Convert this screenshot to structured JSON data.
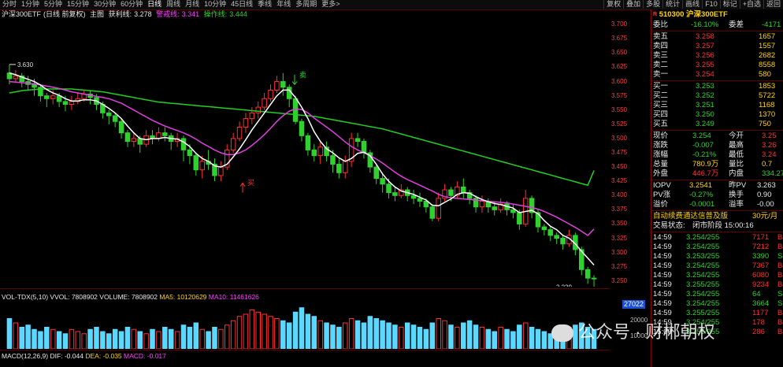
{
  "toolbar": {
    "left": [
      "分时",
      "1分钟",
      "5分钟",
      "15分钟",
      "30分钟",
      "60分钟",
      "日线",
      "周线",
      "月线",
      "10分钟",
      "45日线",
      "季线",
      "年线",
      "多周期",
      "更多>"
    ],
    "active_index": 6,
    "right": [
      "复权",
      "叠加",
      "多股",
      "统计",
      "画线",
      "F10",
      "标记",
      "+自选",
      "返回"
    ]
  },
  "header": {
    "name": "沪深300ETF",
    "mode": "(日线 前复权)",
    "main_label": "主图",
    "l1_name": "获利线:",
    "l1_value": "3.278",
    "l2_name": "警戒线:",
    "l2_value": "3.341",
    "l3_name": "操作线:",
    "l3_value": "3.444"
  },
  "price_axis": [
    "3.700",
    "3.675",
    "3.650",
    "3.625",
    "3.600",
    "3.575",
    "3.550",
    "3.525",
    "3.500",
    "3.475",
    "3.450",
    "3.425",
    "3.400",
    "3.375",
    "3.350",
    "3.325",
    "3.300",
    "3.275",
    "3.250"
  ],
  "annotations": {
    "high": "3.630",
    "low": "3.239",
    "sell": "卖",
    "buy": "买"
  },
  "volume": {
    "label": "VOL-TDX(5,10)",
    "vvol": "VVOL: 7808902",
    "volume": "VOLUME: 7808902",
    "ma5": "MA5: 10120629",
    "ma10": "MA10: 11461626",
    "box": "27022",
    "tick": "20000",
    "tick2": "10000"
  },
  "macd": {
    "label": "MACD(12,26,9)",
    "dif": "DIF: -0.044",
    "dea": "DEA: -0.035",
    "macd": "MACD: -0.017"
  },
  "panel": {
    "code": "510300",
    "name": "沪深300ETF",
    "weibi": {
      "l1": "委比",
      "v1": "-16.10%",
      "l2": "委差",
      "v2": "-4171"
    },
    "asks": [
      {
        "label": "卖五",
        "price": "3.258",
        "vol": "1657"
      },
      {
        "label": "卖四",
        "price": "3.257",
        "vol": "1557"
      },
      {
        "label": "卖三",
        "price": "3.256",
        "vol": "2682"
      },
      {
        "label": "卖二",
        "price": "3.255",
        "vol": "8558"
      },
      {
        "label": "卖一",
        "price": "3.254",
        "vol": "580"
      }
    ],
    "bids": [
      {
        "label": "买一",
        "price": "3.253",
        "vol": "1853"
      },
      {
        "label": "买二",
        "price": "3.252",
        "vol": "5722"
      },
      {
        "label": "买三",
        "price": "3.251",
        "vol": "1168"
      },
      {
        "label": "买四",
        "price": "3.250",
        "vol": "1370"
      },
      {
        "label": "买五",
        "price": "3.249",
        "vol": "750"
      }
    ],
    "stats": [
      {
        "l1": "现价",
        "v1": "3.254",
        "l2": "今开",
        "v2": "3.25"
      },
      {
        "l1": "涨跌",
        "v1": "-0.007",
        "l2": "最高",
        "v2": "3.26"
      },
      {
        "l1": "涨幅",
        "v1": "-0.21%",
        "l2": "最低",
        "v2": "3.24"
      },
      {
        "l1": "总量",
        "v1": "780.9万",
        "l2": "量比",
        "v2": "0.7"
      },
      {
        "l1": "外盘",
        "v1": "446.7万",
        "l2": "内盘",
        "v2": "334.27"
      }
    ],
    "iopv": [
      {
        "l1": "IOPV",
        "v1": "3.2541",
        "l2": "昨PV",
        "v2": "3.263"
      },
      {
        "l1": "PV涨",
        "v1": "-0.27%",
        "l2": "换手",
        "v2": "0.90"
      },
      {
        "l1": "溢价",
        "v1": "-0.0001",
        "l2": "溢率",
        "v2": "-0.00"
      }
    ],
    "promo": {
      "text": "自动续费通达信普及版",
      "price": "30元/月"
    },
    "status": {
      "label": "交易状态:",
      "value": "闭市阶段 15:00:16"
    },
    "trades": [
      {
        "time": "14:59",
        "price": "3.254/255",
        "vol": "7171",
        "flag": "B"
      },
      {
        "time": "14:59",
        "price": "3.254/255",
        "vol": "7212",
        "flag": "B"
      },
      {
        "time": "14:59",
        "price": "3.253/255",
        "vol": "3390",
        "flag": "S"
      },
      {
        "time": "14:59",
        "price": "3.254/255",
        "vol": "7367",
        "flag": "B"
      },
      {
        "time": "14:59",
        "price": "3.254/255",
        "vol": "6080",
        "flag": "B"
      },
      {
        "time": "14:59",
        "price": "3.255/255",
        "vol": "9234",
        "flag": "B"
      },
      {
        "time": "14:59",
        "price": "3.254/255",
        "vol": "64",
        "flag": "S"
      },
      {
        "time": "14:59",
        "price": "3.254/255",
        "vol": "3664",
        "flag": "S"
      },
      {
        "time": "14:59",
        "price": "3.255/255",
        "vol": "1177",
        "flag": "B"
      },
      {
        "time": "14:59",
        "price": "3.254/255",
        "vol": "178",
        "flag": "B"
      },
      {
        "time": "15:00",
        "price": "3.255/255",
        "vol": "286",
        "flag": "B"
      }
    ]
  },
  "watermark": {
    "text": "公众号 · 财郴朝权"
  },
  "colors": {
    "up": "#ff3030",
    "down": "#2fd12f",
    "ma_white": "#ffffff",
    "ma_magenta": "#e040e0",
    "ma_green": "#22d022",
    "vol_bar": "#5ad8ff"
  },
  "chart_data": {
    "type": "candlestick",
    "ylim": [
      3.24,
      3.71
    ],
    "candles": [
      [
        3.615,
        3.605,
        3.63,
        3.595
      ],
      [
        3.605,
        3.61,
        3.62,
        3.598
      ],
      [
        3.61,
        3.6,
        3.615,
        3.59
      ],
      [
        3.6,
        3.595,
        3.61,
        3.585
      ],
      [
        3.595,
        3.59,
        3.605,
        3.575
      ],
      [
        3.59,
        3.575,
        3.595,
        3.565
      ],
      [
        3.575,
        3.57,
        3.58,
        3.555
      ],
      [
        3.57,
        3.575,
        3.585,
        3.56
      ],
      [
        3.575,
        3.565,
        3.58,
        3.555
      ],
      [
        3.565,
        3.56,
        3.575,
        3.548
      ],
      [
        3.56,
        3.565,
        3.575,
        3.55
      ],
      [
        3.565,
        3.57,
        3.58,
        3.56
      ],
      [
        3.57,
        3.578,
        3.585,
        3.565
      ],
      [
        3.578,
        3.572,
        3.585,
        3.56
      ],
      [
        3.572,
        3.56,
        3.578,
        3.55
      ],
      [
        3.56,
        3.545,
        3.565,
        3.535
      ],
      [
        3.545,
        3.54,
        3.55,
        3.525
      ],
      [
        3.54,
        3.53,
        3.545,
        3.52
      ],
      [
        3.53,
        3.51,
        3.535,
        3.5
      ],
      [
        3.51,
        3.495,
        3.515,
        3.485
      ],
      [
        3.495,
        3.5,
        3.51,
        3.485
      ],
      [
        3.5,
        3.49,
        3.505,
        3.475
      ],
      [
        3.49,
        3.505,
        3.515,
        3.485
      ],
      [
        3.505,
        3.5,
        3.515,
        3.49
      ],
      [
        3.5,
        3.51,
        3.52,
        3.495
      ],
      [
        3.51,
        3.505,
        3.52,
        3.495
      ],
      [
        3.505,
        3.495,
        3.51,
        3.48
      ],
      [
        3.495,
        3.5,
        3.51,
        3.485
      ],
      [
        3.5,
        3.48,
        3.505,
        3.46
      ],
      [
        3.48,
        3.47,
        3.49,
        3.455
      ],
      [
        3.47,
        3.445,
        3.475,
        3.435
      ],
      [
        3.445,
        3.46,
        3.47,
        3.43
      ],
      [
        3.46,
        3.455,
        3.48,
        3.445
      ],
      [
        3.455,
        3.435,
        3.465,
        3.425
      ],
      [
        3.435,
        3.45,
        3.46,
        3.425
      ],
      [
        3.45,
        3.48,
        3.49,
        3.445
      ],
      [
        3.48,
        3.5,
        3.51,
        3.475
      ],
      [
        3.5,
        3.52,
        3.53,
        3.495
      ],
      [
        3.52,
        3.535,
        3.545,
        3.51
      ],
      [
        3.535,
        3.545,
        3.555,
        3.525
      ],
      [
        3.545,
        3.555,
        3.565,
        3.535
      ],
      [
        3.555,
        3.57,
        3.58,
        3.55
      ],
      [
        3.57,
        3.585,
        3.595,
        3.565
      ],
      [
        3.585,
        3.6,
        3.61,
        3.58
      ],
      [
        3.6,
        3.59,
        3.615,
        3.575
      ],
      [
        3.59,
        3.57,
        3.595,
        3.555
      ],
      [
        3.57,
        3.53,
        3.575,
        3.525
      ],
      [
        3.53,
        3.505,
        3.535,
        3.495
      ],
      [
        3.505,
        3.48,
        3.51,
        3.47
      ],
      [
        3.48,
        3.47,
        3.49,
        3.46
      ],
      [
        3.47,
        3.485,
        3.495,
        3.455
      ],
      [
        3.485,
        3.47,
        3.495,
        3.46
      ],
      [
        3.47,
        3.455,
        3.48,
        3.44
      ],
      [
        3.455,
        3.44,
        3.465,
        3.43
      ],
      [
        3.44,
        3.46,
        3.47,
        3.43
      ],
      [
        3.46,
        3.5,
        3.51,
        3.45
      ],
      [
        3.5,
        3.495,
        3.51,
        3.485
      ],
      [
        3.495,
        3.475,
        3.5,
        3.465
      ],
      [
        3.475,
        3.45,
        3.48,
        3.44
      ],
      [
        3.45,
        3.43,
        3.455,
        3.42
      ],
      [
        3.43,
        3.42,
        3.44,
        3.405
      ],
      [
        3.42,
        3.405,
        3.43,
        3.395
      ],
      [
        3.405,
        3.4,
        3.415,
        3.39
      ],
      [
        3.4,
        3.41,
        3.42,
        3.395
      ],
      [
        3.41,
        3.4,
        3.415,
        3.39
      ],
      [
        3.4,
        3.395,
        3.41,
        3.385
      ],
      [
        3.395,
        3.39,
        3.405,
        3.38
      ],
      [
        3.39,
        3.38,
        3.395,
        3.37
      ],
      [
        3.38,
        3.36,
        3.385,
        3.355
      ],
      [
        3.36,
        3.395,
        3.405,
        3.355
      ],
      [
        3.395,
        3.41,
        3.42,
        3.39
      ],
      [
        3.41,
        3.4,
        3.415,
        3.39
      ],
      [
        3.4,
        3.415,
        3.425,
        3.395
      ],
      [
        3.415,
        3.405,
        3.43,
        3.395
      ],
      [
        3.405,
        3.395,
        3.41,
        3.385
      ],
      [
        3.395,
        3.38,
        3.4,
        3.37
      ],
      [
        3.38,
        3.39,
        3.4,
        3.37
      ],
      [
        3.39,
        3.38,
        3.395,
        3.37
      ],
      [
        3.38,
        3.375,
        3.39,
        3.365
      ],
      [
        3.375,
        3.385,
        3.395,
        3.37
      ],
      [
        3.385,
        3.375,
        3.39,
        3.365
      ],
      [
        3.375,
        3.37,
        3.385,
        3.36
      ],
      [
        3.37,
        3.35,
        3.375,
        3.34
      ],
      [
        3.35,
        3.395,
        3.41,
        3.345
      ],
      [
        3.395,
        3.37,
        3.4,
        3.36
      ],
      [
        3.37,
        3.345,
        3.375,
        3.335
      ],
      [
        3.345,
        3.34,
        3.35,
        3.33
      ],
      [
        3.34,
        3.33,
        3.345,
        3.32
      ],
      [
        3.33,
        3.325,
        3.335,
        3.315
      ],
      [
        3.325,
        3.315,
        3.33,
        3.305
      ],
      [
        3.315,
        3.33,
        3.34,
        3.31
      ],
      [
        3.33,
        3.305,
        3.335,
        3.295
      ],
      [
        3.305,
        3.27,
        3.31,
        3.26
      ],
      [
        3.27,
        3.255,
        3.275,
        3.245
      ],
      [
        3.255,
        3.254,
        3.26,
        3.239
      ]
    ],
    "ma_white": [
      3.615,
      3.612,
      3.608,
      3.604,
      3.6,
      3.594,
      3.586,
      3.58,
      3.576,
      3.57,
      3.566,
      3.566,
      3.568,
      3.568,
      3.566,
      3.56,
      3.553,
      3.545,
      3.535,
      3.522,
      3.51,
      3.5,
      3.498,
      3.5,
      3.5,
      3.502,
      3.5,
      3.499,
      3.494,
      3.486,
      3.474,
      3.465,
      3.46,
      3.452,
      3.45,
      3.455,
      3.468,
      3.482,
      3.498,
      3.515,
      3.53,
      3.545,
      3.56,
      3.575,
      3.585,
      3.585,
      3.572,
      3.555,
      3.535,
      3.512,
      3.495,
      3.482,
      3.475,
      3.466,
      3.46,
      3.465,
      3.474,
      3.476,
      3.47,
      3.455,
      3.438,
      3.425,
      3.415,
      3.408,
      3.405,
      3.402,
      3.397,
      3.392,
      3.383,
      3.382,
      3.388,
      3.394,
      3.402,
      3.405,
      3.404,
      3.398,
      3.393,
      3.389,
      3.386,
      3.384,
      3.381,
      3.378,
      3.37,
      3.372,
      3.374,
      3.368,
      3.356,
      3.346,
      3.34,
      3.33,
      3.325,
      3.315,
      3.302,
      3.29,
      3.278
    ],
    "ma_magenta": [
      3.6,
      3.599,
      3.598,
      3.597,
      3.596,
      3.594,
      3.592,
      3.59,
      3.588,
      3.585,
      3.582,
      3.58,
      3.578,
      3.576,
      3.574,
      3.572,
      3.57,
      3.566,
      3.562,
      3.556,
      3.55,
      3.544,
      3.538,
      3.532,
      3.527,
      3.522,
      3.518,
      3.514,
      3.51,
      3.505,
      3.499,
      3.492,
      3.486,
      3.48,
      3.475,
      3.472,
      3.472,
      3.475,
      3.48,
      3.488,
      3.497,
      3.507,
      3.518,
      3.53,
      3.54,
      3.548,
      3.552,
      3.551,
      3.545,
      3.536,
      3.528,
      3.52,
      3.512,
      3.503,
      3.494,
      3.486,
      3.48,
      3.475,
      3.47,
      3.464,
      3.457,
      3.449,
      3.441,
      3.434,
      3.428,
      3.423,
      3.418,
      3.413,
      3.408,
      3.402,
      3.398,
      3.396,
      3.395,
      3.394,
      3.393,
      3.392,
      3.391,
      3.39,
      3.389,
      3.388,
      3.387,
      3.385,
      3.383,
      3.381,
      3.379,
      3.376,
      3.372,
      3.367,
      3.362,
      3.356,
      3.35,
      3.344,
      3.337,
      3.33,
      3.341
    ],
    "ma_green": [
      3.58,
      3.582,
      3.584,
      3.585,
      3.586,
      3.587,
      3.587,
      3.587,
      3.587,
      3.587,
      3.587,
      3.586,
      3.585,
      3.584,
      3.583,
      3.582,
      3.58,
      3.578,
      3.576,
      3.574,
      3.572,
      3.57,
      3.568,
      3.566,
      3.564,
      3.563,
      3.562,
      3.561,
      3.56,
      3.559,
      3.558,
      3.557,
      3.556,
      3.555,
      3.554,
      3.553,
      3.552,
      3.551,
      3.55,
      3.549,
      3.548,
      3.547,
      3.546,
      3.545,
      3.544,
      3.543,
      3.542,
      3.541,
      3.54,
      3.539,
      3.537,
      3.535,
      3.533,
      3.531,
      3.529,
      3.527,
      3.525,
      3.523,
      3.521,
      3.519,
      3.517,
      3.514,
      3.511,
      3.508,
      3.505,
      3.502,
      3.499,
      3.496,
      3.493,
      3.49,
      3.487,
      3.484,
      3.481,
      3.478,
      3.475,
      3.472,
      3.469,
      3.466,
      3.463,
      3.46,
      3.457,
      3.454,
      3.451,
      3.448,
      3.445,
      3.442,
      3.439,
      3.436,
      3.433,
      3.43,
      3.427,
      3.424,
      3.421,
      3.418,
      3.444
    ],
    "volume": [
      14,
      12,
      10,
      11,
      9,
      8,
      10,
      9,
      8,
      7,
      9,
      8,
      7,
      9,
      10,
      8,
      7,
      9,
      8,
      10,
      9,
      8,
      7,
      9,
      8,
      10,
      9,
      8,
      11,
      10,
      12,
      9,
      8,
      10,
      9,
      11,
      13,
      15,
      16,
      18,
      17,
      16,
      15,
      14,
      13,
      12,
      17,
      19,
      16,
      15,
      13,
      12,
      11,
      10,
      12,
      14,
      13,
      12,
      15,
      14,
      13,
      12,
      11,
      10,
      12,
      11,
      10,
      9,
      12,
      14,
      13,
      11,
      10,
      12,
      13,
      11,
      10,
      9,
      8,
      10,
      9,
      8,
      11,
      12,
      10,
      9,
      8,
      7,
      9,
      8,
      10,
      11,
      12,
      10,
      9
    ]
  }
}
